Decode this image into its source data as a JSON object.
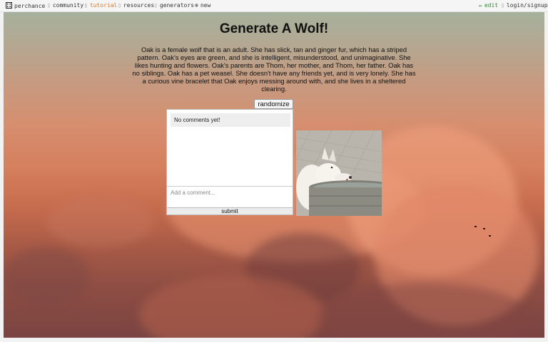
{
  "nav": {
    "logo_label": "perchance",
    "community_label": "community",
    "tutorial_label": "tutorial",
    "resources_label": "resources",
    "generators_label": "generators",
    "new_label": "new",
    "edit_label": "edit",
    "login_label": "login/signup"
  },
  "icons": {
    "logo": "dice-icon",
    "community": "chat-icon",
    "tutorial": "book-icon",
    "resources": "link-icon",
    "generators": "list-icon",
    "new": "plus-circle-icon",
    "edit": "pencil-icon",
    "login": "user-icon"
  },
  "colors": {
    "tutorial": "#e0762a",
    "edit": "#2e8b2e"
  },
  "main": {
    "title": "Generate A Wolf!",
    "description": "Oak is a female wolf that is an adult. She has slick, tan and ginger fur, which has a striped pattern. Oak's eyes are green, and she is intelligent, misunderstood, and unimaginative. She likes hunting and flowers. Oak's parents are Thom, her mother, and Thom, her father. Oak has no siblings. Oak has a pet weasel. She doesn't have any friends yet, and is very lonely. She has a curious vine bracelet that Oak enjoys messing around with, and she lives in a sheltered clearing.",
    "randomize_label": "randomize"
  },
  "comments": {
    "empty_text": "No comments yet!",
    "placeholder": "Add a comment...",
    "submit_label": "submit"
  }
}
